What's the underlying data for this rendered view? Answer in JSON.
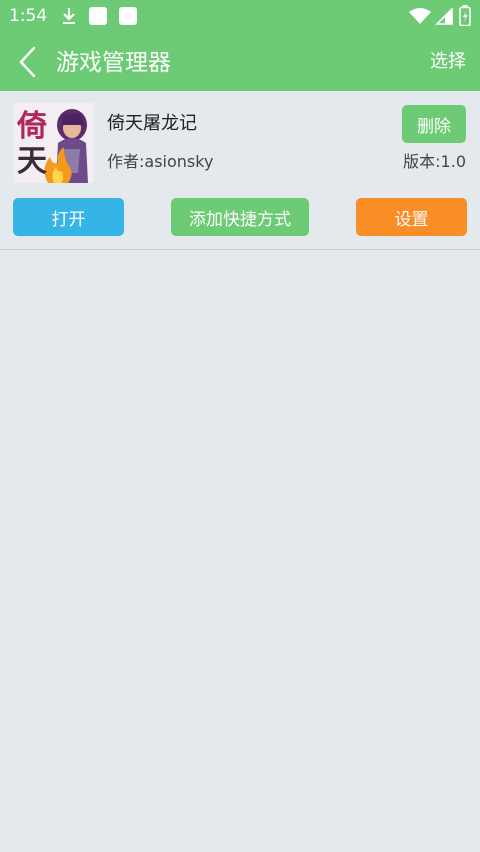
{
  "status_bar": {
    "time": "1:54",
    "icons": [
      "download-icon",
      "notification-square-icon",
      "notification-square-icon",
      "wifi-icon",
      "signal-icon",
      "battery-icon"
    ]
  },
  "app_bar": {
    "title": "游戏管理器",
    "action": "选择",
    "back_icon": "chevron-left-icon"
  },
  "game": {
    "name": "倚天屠龙记",
    "author": "作者:asionsky",
    "version": "版本:1.0",
    "icon_text_1": "倚",
    "icon_text_2": "天",
    "delete_label": "删除",
    "open_label": "打开",
    "shortcut_label": "添加快捷方式",
    "settings_label": "设置"
  },
  "colors": {
    "header_green": "#6ccb74",
    "background": "#e4e9ed",
    "open_blue": "#35b4e6",
    "settings_orange": "#f98d26"
  }
}
